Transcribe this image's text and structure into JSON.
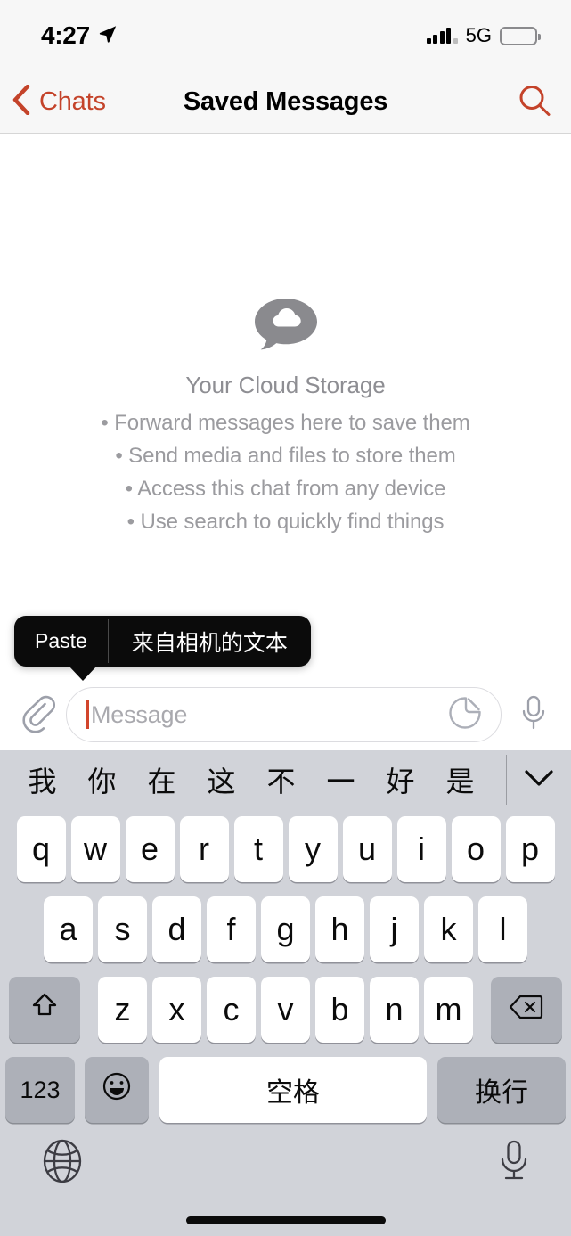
{
  "status_bar": {
    "time": "4:27",
    "location_icon": "location-arrow-icon",
    "network_label": "5G",
    "signal_icon": "signal-bars-icon",
    "battery_icon": "battery-low-icon",
    "battery_level_percent": 13,
    "battery_color": "#F03A2E"
  },
  "nav": {
    "back_label": "Chats",
    "back_icon": "chevron-left-icon",
    "title": "Saved Messages",
    "search_icon": "search-icon",
    "accent_color": "#C4432A"
  },
  "empty_state": {
    "icon": "cloud-chat-bubble-icon",
    "title": "Your Cloud Storage",
    "items": [
      "• Forward messages here to save them",
      "• Send media and files to store them",
      "• Access this chat from any device",
      "• Use search to quickly find things"
    ]
  },
  "paste_menu": {
    "items": [
      {
        "label": "Paste",
        "name": "paste-menu-item"
      },
      {
        "label": "来自相机的文本",
        "name": "scan-text-menu-item"
      }
    ]
  },
  "input_bar": {
    "attach_icon": "paperclip-icon",
    "placeholder": "Message",
    "value": "",
    "sticker_icon": "sticker-icon",
    "mic_icon": "microphone-icon",
    "caret_color": "#D2452C"
  },
  "keyboard": {
    "suggestions": [
      "我",
      "你",
      "在",
      "这",
      "不",
      "一",
      "好",
      "是",
      "我"
    ],
    "expand_icon": "chevron-down-icon",
    "rows": {
      "row1": [
        "q",
        "w",
        "e",
        "r",
        "t",
        "y",
        "u",
        "i",
        "o",
        "p"
      ],
      "row2": [
        "a",
        "s",
        "d",
        "f",
        "g",
        "h",
        "j",
        "k",
        "l"
      ],
      "row3": [
        "z",
        "x",
        "c",
        "v",
        "b",
        "n",
        "m"
      ]
    },
    "shift_icon": "shift-arrow-icon",
    "backspace_icon": "backspace-icon",
    "numbers_label": "123",
    "emoji_icon": "smiley-face-icon",
    "space_label": "空格",
    "return_label": "换行",
    "globe_icon": "globe-icon",
    "dictation_icon": "microphone-icon",
    "background_color": "#D1D3D9"
  }
}
